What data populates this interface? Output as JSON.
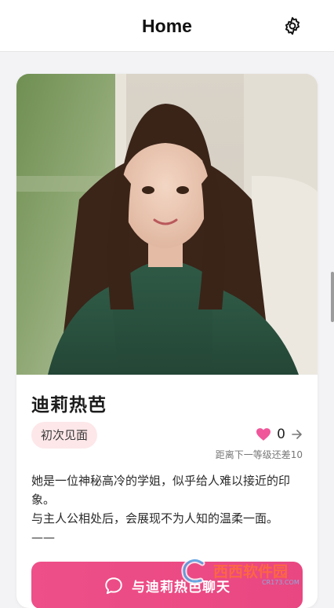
{
  "header": {
    "title": "Home",
    "settings_icon": "gear-icon"
  },
  "character": {
    "name": "迪莉热芭",
    "status": "初次见面",
    "affection_count": "0",
    "affection_icon": "heart-icon",
    "level_note": "距离下一等级还差10",
    "description": "她是一位神秘高冷的学姐，似乎给人难以接近的印象。\n与主人公相处后，会展现不为人知的温柔一面。——",
    "photo_icon": "character-portrait"
  },
  "chat_button": {
    "label": "与迪莉热芭聊天",
    "icon": "chat-bubble-icon"
  },
  "watermark": {
    "text": "西西软件园",
    "sub": "CR173.COM"
  },
  "colors": {
    "accent": "#EE4F88",
    "badge_bg": "#FDE7E9",
    "heart": "#F0569A"
  }
}
